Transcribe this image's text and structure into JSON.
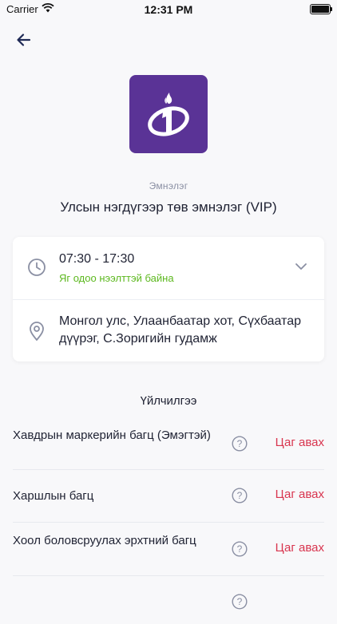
{
  "status_bar": {
    "carrier": "Carrier",
    "time": "12:31 PM"
  },
  "header": {
    "back_icon": "arrow-left-icon"
  },
  "hospital": {
    "category": "Эмнэлэг",
    "name": "Улсын нэгдүгээр төв эмнэлэг (VIP)",
    "logo_color": "#5a3396",
    "logo_icon": "hospital-logo-icon"
  },
  "info": {
    "hours": "07:30 - 17:30",
    "open_status": "Яг одоо нээлттэй байна",
    "open_status_color": "#5cb81e",
    "address": "Монгол улс, Улаанбаатар хот, Сүхбаатар дүүрэг, С.Зоригийн гудамж"
  },
  "services": {
    "title": "Үйлчилгээ",
    "book_label_color": "#d8344e",
    "items": [
      {
        "name": "Хавдрын маркерийн багц (Эмэгтэй)",
        "book_label": "Цаг авах"
      },
      {
        "name": "Харшлын багц",
        "book_label": "Цаг авах"
      },
      {
        "name": "Хоол боловсруулах эрхтний багц",
        "book_label": "Цаг авах"
      },
      {
        "name": "",
        "book_label": ""
      }
    ]
  }
}
